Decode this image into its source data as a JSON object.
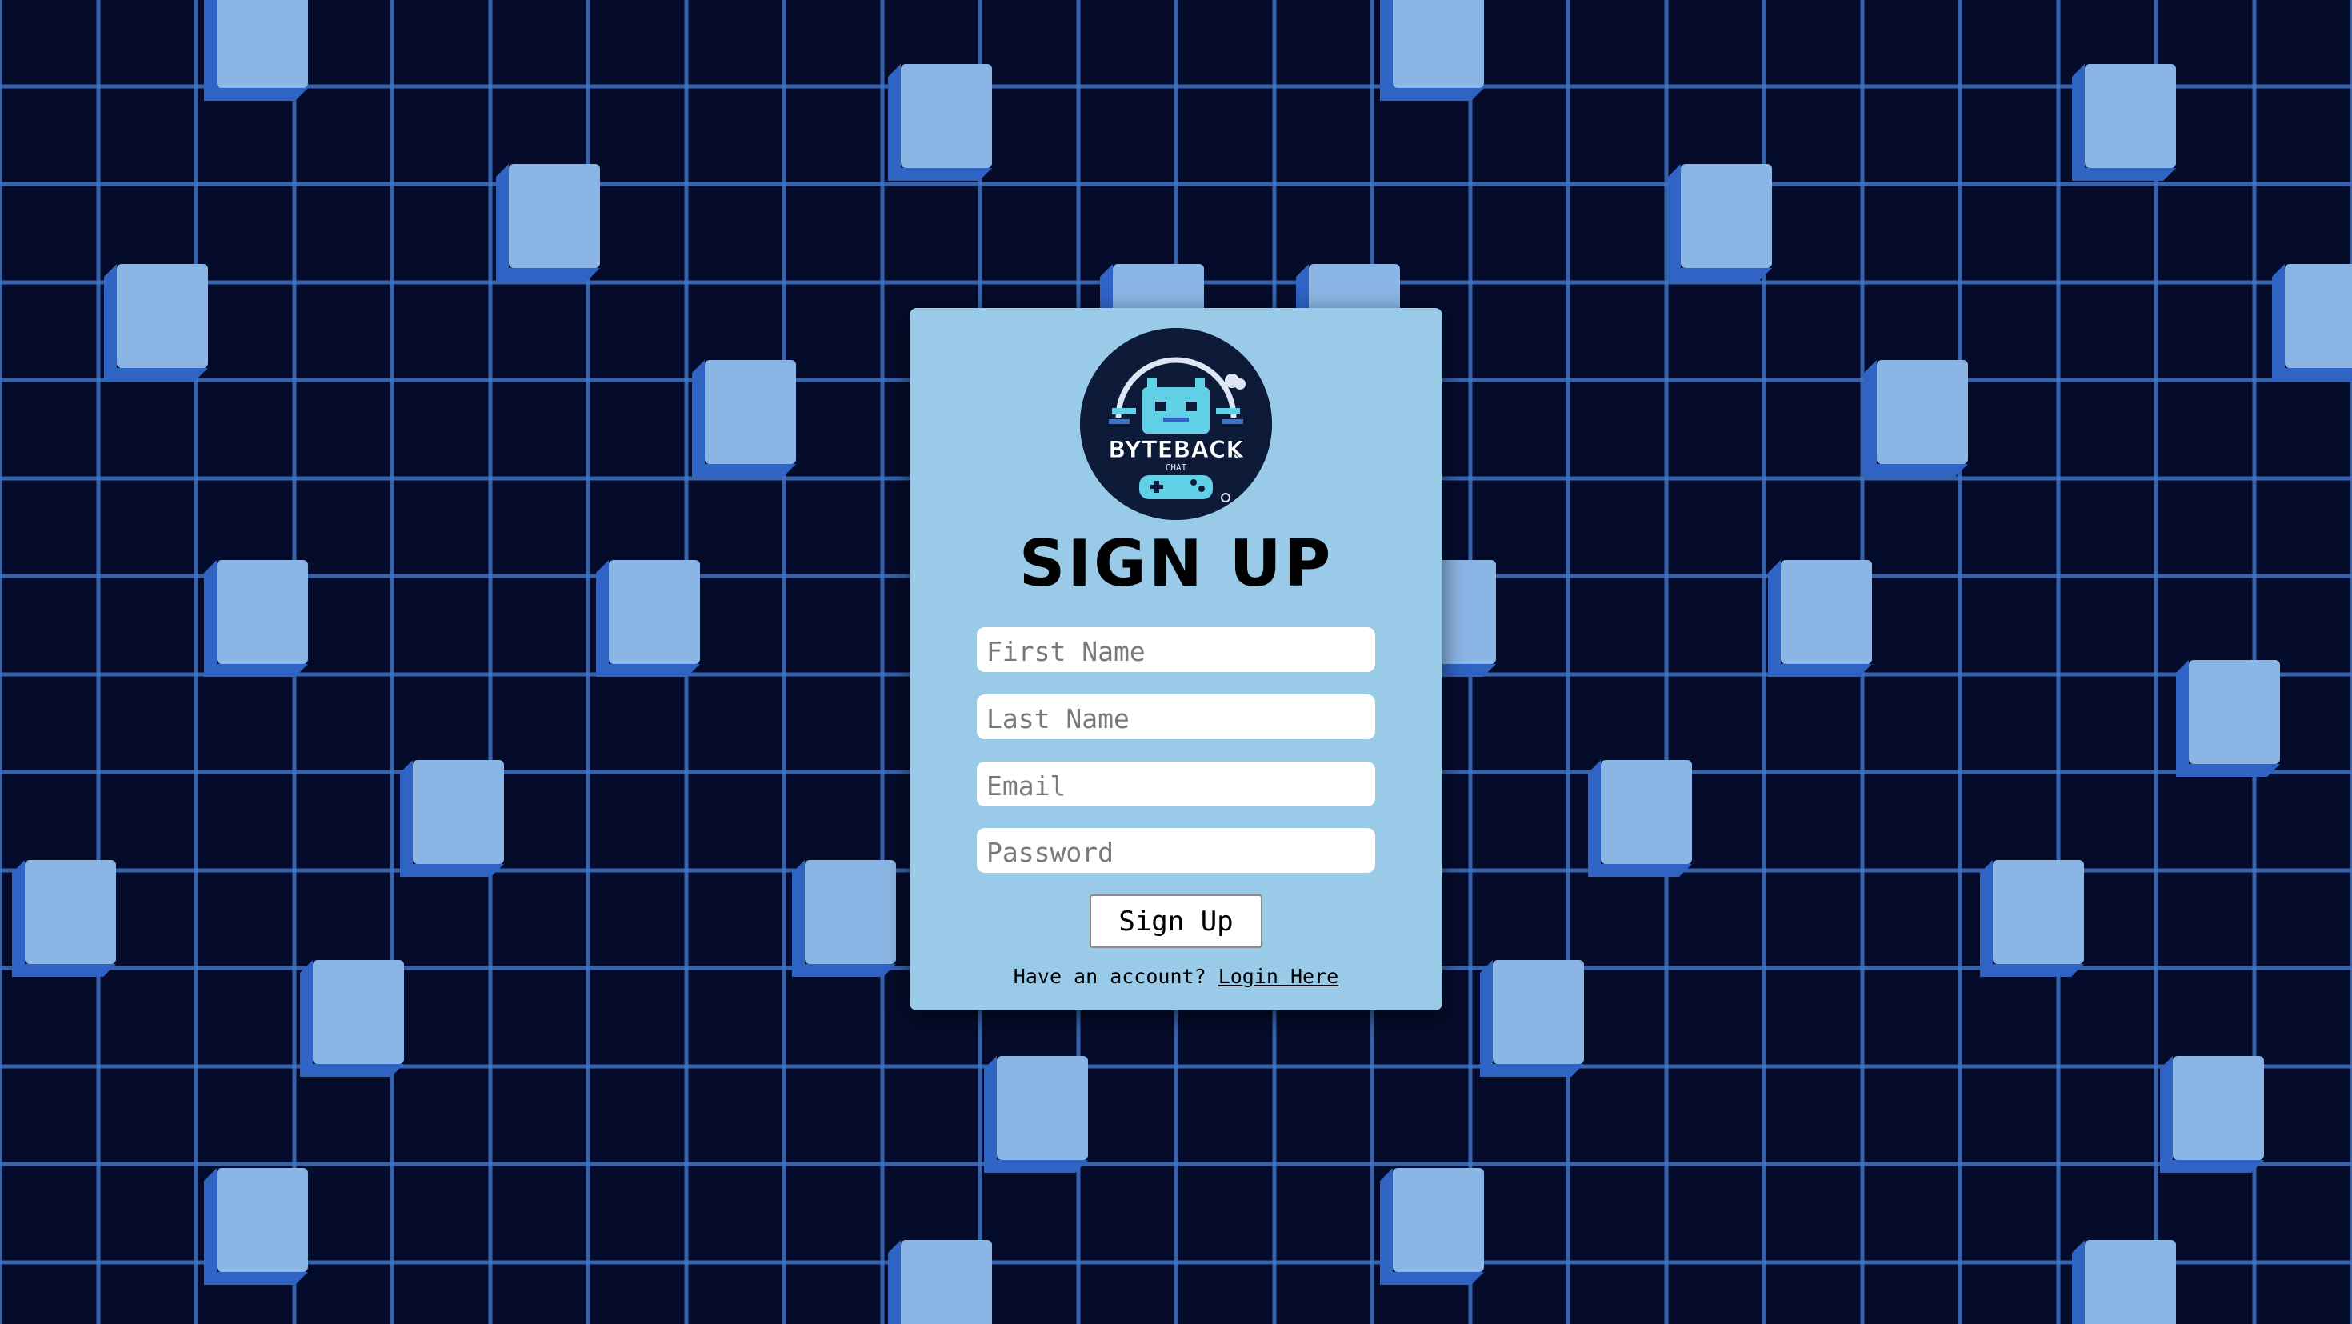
{
  "signup": {
    "title": "SIGN UP",
    "logo": {
      "text": "BYTEBACK",
      "subtext": "CHAT"
    },
    "fields": {
      "first_name": {
        "placeholder": "First Name",
        "value": ""
      },
      "last_name": {
        "placeholder": "Last Name",
        "value": ""
      },
      "email": {
        "placeholder": "Email",
        "value": ""
      },
      "password": {
        "placeholder": "Password",
        "value": ""
      }
    },
    "submit_label": "Sign Up",
    "footer": {
      "prompt": "Have an account?",
      "link_label": "Login Here"
    }
  },
  "colors": {
    "background": "#050c2b",
    "grid_line": "#3f73c4",
    "cube_face": "#8bb5e4",
    "cube_side": "#2f63c4",
    "card": "#99cbe8",
    "logo_bg": "#0d1a38",
    "logo_accent": "#5fd0e6"
  }
}
